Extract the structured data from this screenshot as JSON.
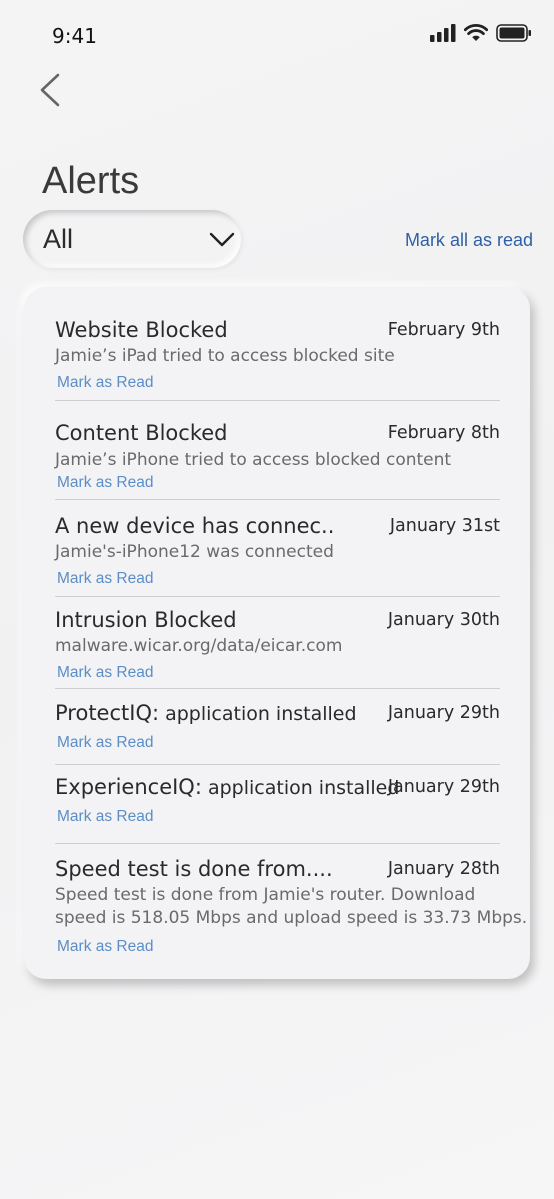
{
  "status_bar": {
    "time": "9:41",
    "icons": [
      "signal-icon",
      "wifi-icon",
      "battery-icon"
    ]
  },
  "nav": {
    "back_icon": "chevron-left-icon"
  },
  "page": {
    "title": "Alerts"
  },
  "filter": {
    "selected": "All",
    "chevron_icon": "chevron-down-icon"
  },
  "mark_all_label": "Mark all as read",
  "alerts": [
    {
      "title": "Website Blocked",
      "date": "February 9th",
      "description": "Jamie’s iPad tried to access blocked site",
      "action": "Mark as Read"
    },
    {
      "title": "Content Blocked",
      "date": "February 8th",
      "description": "Jamie’s iPhone tried to access blocked content",
      "action": "Mark as Read"
    },
    {
      "title": "A new device has connec..",
      "date": "January 31st",
      "description": "Jamie's-iPhone12 was connected",
      "action": "Mark as Read"
    },
    {
      "title": "Intrusion Blocked",
      "date": "January 30th",
      "description": "malware.wicar.org/data/eicar.com",
      "action": "Mark as Read"
    },
    {
      "title": "ProtectIQ:",
      "title_suffix": " application installed",
      "date": "January 29th",
      "action": "Mark as Read"
    },
    {
      "title": "ExperienceIQ:",
      "title_suffix": " application installed",
      "date": "January 29th",
      "action": "Mark as Read"
    },
    {
      "title": "Speed test is done from....",
      "date": "January 28th",
      "description_lines": [
        "Speed test is done from Jamie's router. Download",
        "speed is 518.05 Mbps and upload speed is 33.73 Mbps."
      ],
      "action": "Mark as Read"
    }
  ],
  "colors": {
    "link": "#5b8dc6",
    "accent": "#2e5fa8",
    "card_bg": "#f3f3f5",
    "background": "#f2f2f3"
  }
}
